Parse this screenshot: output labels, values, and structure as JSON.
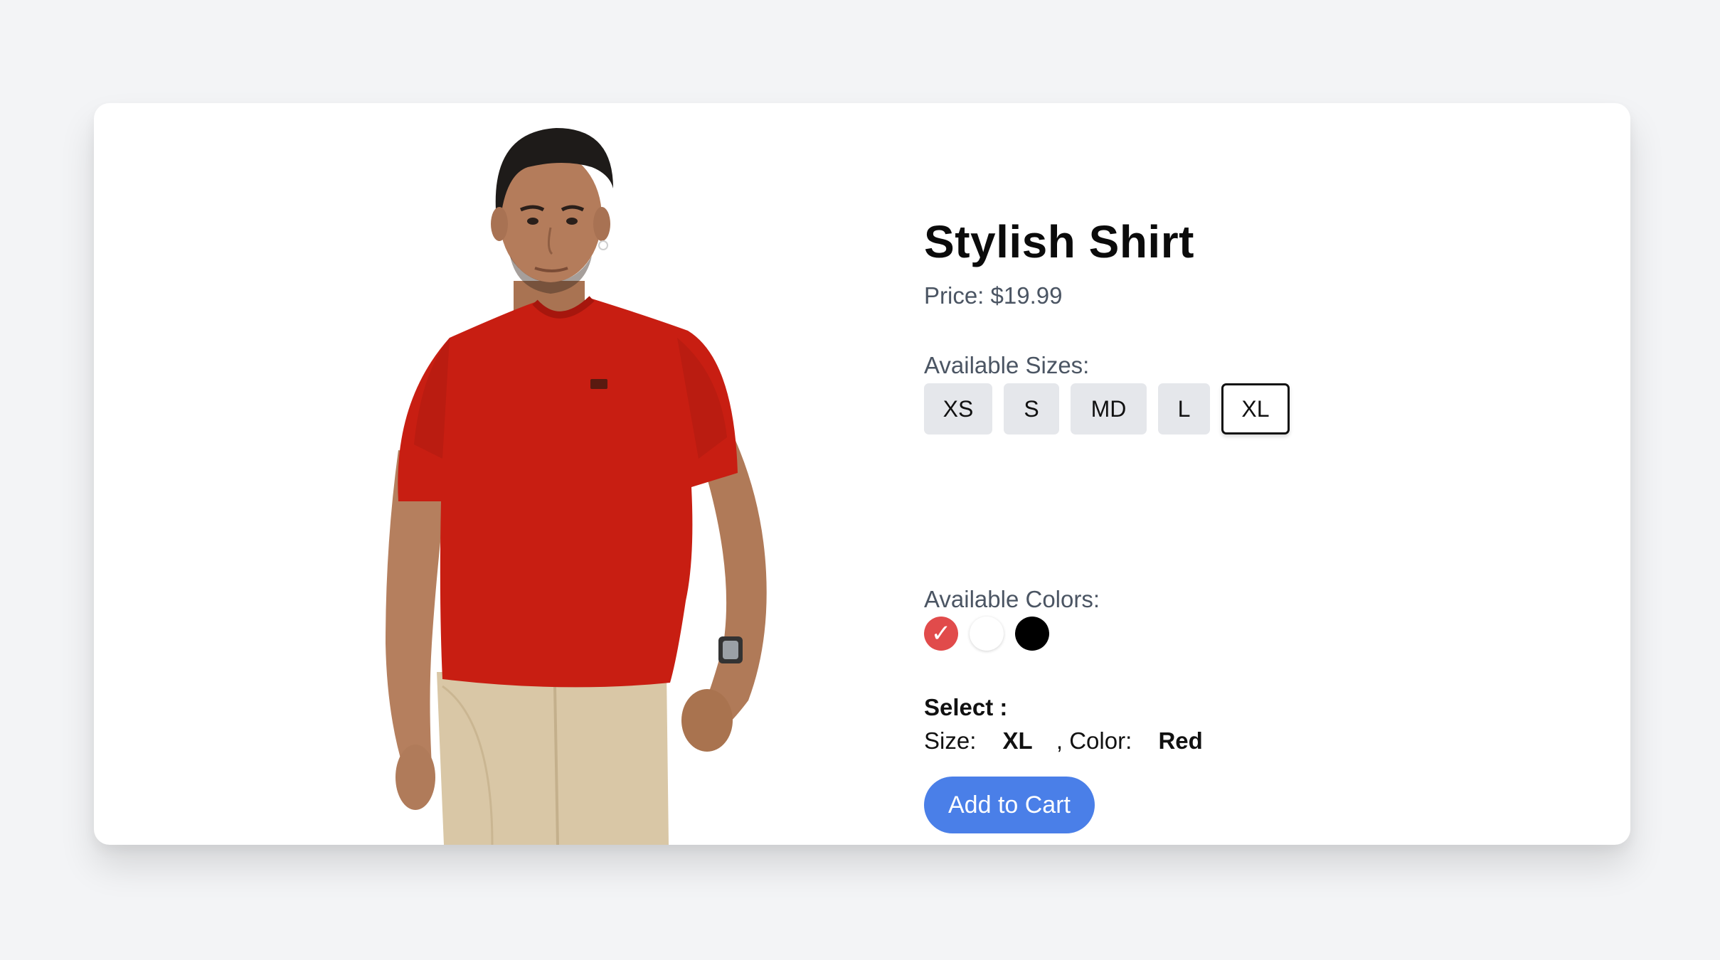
{
  "product": {
    "title": "Stylish Shirt",
    "price_label": "Price: $19.99",
    "image_alt": "Man wearing red t-shirt and beige trousers"
  },
  "sizes": {
    "label": "Available Sizes:",
    "options": [
      "XS",
      "S",
      "MD",
      "L",
      "XL"
    ],
    "selected": "XL"
  },
  "colors": {
    "label": "Available Colors:",
    "options": [
      {
        "name": "Red",
        "hex": "#e14b4b",
        "selected": true
      },
      {
        "name": "White",
        "hex": "#ffffff",
        "selected": false
      },
      {
        "name": "Black",
        "hex": "#000000",
        "selected": false
      }
    ],
    "check_glyph": "✓"
  },
  "selection": {
    "heading": "Select :",
    "size_label": "Size:",
    "size_value": "XL",
    "color_label": ", Color:",
    "color_value": "Red"
  },
  "cart": {
    "button_label": "Add to Cart",
    "button_color": "#4a7fe8"
  }
}
